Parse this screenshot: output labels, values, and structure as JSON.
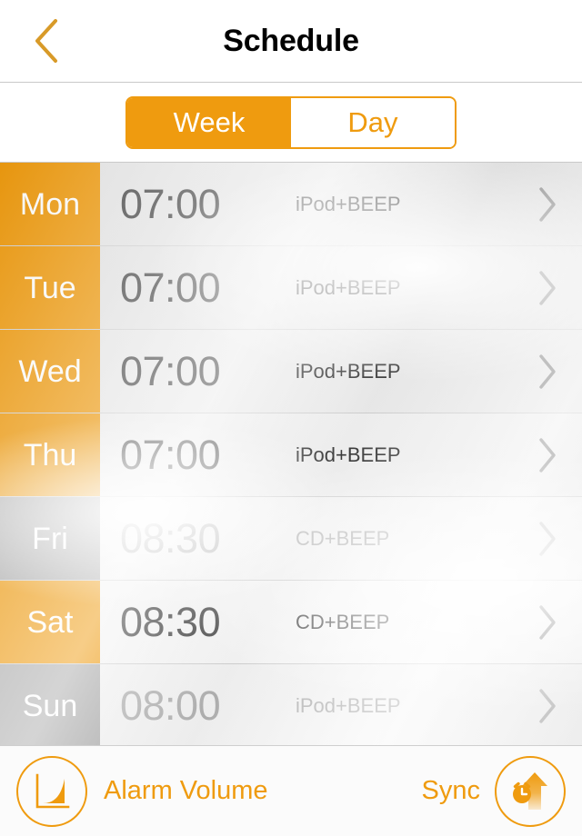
{
  "theme": {
    "accent": "#ef9b0f",
    "disabled_gray": "#aaaaaa",
    "title_color": "#000000",
    "time_color": "#4a4a4a",
    "time_color_disabled": "#b2b2b2"
  },
  "navbar": {
    "back_icon": "chevron-left-icon",
    "title": "Schedule"
  },
  "segmented_control": {
    "options": [
      {
        "label": "Week",
        "selected": true
      },
      {
        "label": "Day",
        "selected": false
      }
    ],
    "selected": "Week"
  },
  "schedule": {
    "rows": [
      {
        "day": "Mon",
        "time": "07:00",
        "sound": "iPod+BEEP",
        "enabled": true,
        "chevron": "chevron-right-icon"
      },
      {
        "day": "Tue",
        "time": "07:00",
        "sound": "iPod+BEEP",
        "enabled": true,
        "chevron": "chevron-right-icon"
      },
      {
        "day": "Wed",
        "time": "07:00",
        "sound": "iPod+BEEP",
        "enabled": true,
        "chevron": "chevron-right-icon"
      },
      {
        "day": "Thu",
        "time": "07:00",
        "sound": "iPod+BEEP",
        "enabled": true,
        "chevron": "chevron-right-icon"
      },
      {
        "day": "Fri",
        "time": "08:30",
        "sound": "CD+BEEP",
        "enabled": false,
        "chevron": "chevron-right-icon"
      },
      {
        "day": "Sat",
        "time": "08:30",
        "sound": "CD+BEEP",
        "enabled": true,
        "chevron": "chevron-right-icon"
      },
      {
        "day": "Sun",
        "time": "08:00",
        "sound": "iPod+BEEP",
        "enabled": false,
        "chevron": "chevron-right-icon"
      }
    ]
  },
  "toolbar": {
    "alarm_volume_label": "Alarm Volume",
    "alarm_volume_icon": "volume-ramp-chart-icon",
    "sync_label": "Sync",
    "sync_icon": "alarm-clock-upload-icon"
  }
}
